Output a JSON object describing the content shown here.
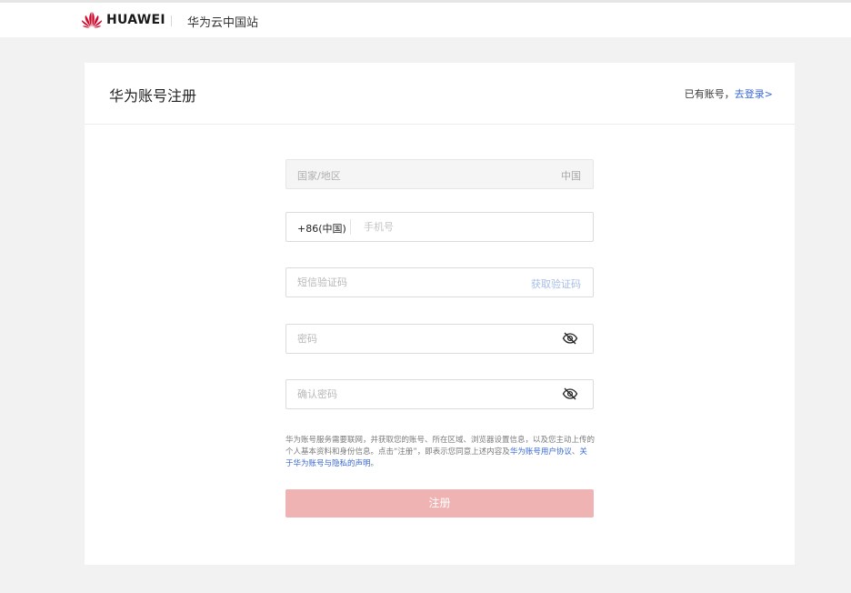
{
  "header": {
    "brand": "HUAWEI",
    "site_name": "华为云中国站",
    "brand_color": "#cf0a2c"
  },
  "card": {
    "title": "华为账号注册",
    "login_prompt": "已有账号，",
    "login_link": "去登录>"
  },
  "form": {
    "country": {
      "label": "国家/地区",
      "value": "中国"
    },
    "phone": {
      "prefix": "+86(中国)",
      "placeholder": "手机号",
      "value": ""
    },
    "sms_code": {
      "placeholder": "短信验证码",
      "get_code_label": "获取验证码",
      "value": ""
    },
    "password": {
      "placeholder": "密码",
      "value": "",
      "toggle_icon": "eye-off-icon"
    },
    "confirm_password": {
      "placeholder": "确认密码",
      "value": "",
      "toggle_icon": "eye-off-icon"
    },
    "agreement": {
      "text": "华为账号服务需要联网，并获取您的账号、所在区域、浏览器设置信息，以及您主动上传的个人基本资料和身份信息。点击“注册”，即表示您同意上述内容及",
      "link1": "华为账号用户协议",
      "separator": "、",
      "link2": "关于华为账号与隐私的声明",
      "end": "。"
    },
    "submit_label": "注册",
    "submit_color": "#efb3b3"
  }
}
